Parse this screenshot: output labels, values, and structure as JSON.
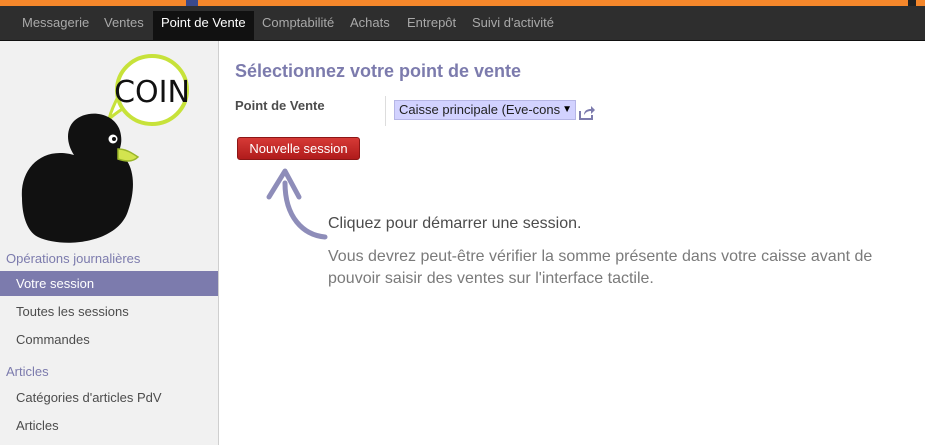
{
  "colors": {
    "accent": "#7c7bad",
    "top_stripe": "#f5872b",
    "navbar": "#2e2e2e",
    "button": "#c12b27"
  },
  "navbar": {
    "items": [
      "Messagerie",
      "Ventes",
      "Point de Vente",
      "Comptabilité",
      "Achats",
      "Entrepôt",
      "Suivi d'activité"
    ],
    "active": "Point de Vente"
  },
  "logo": {
    "bubble_text": "COIN"
  },
  "sidebar": {
    "section1": "Opérations journalières",
    "items1": [
      "Votre session",
      "Toutes les sessions",
      "Commandes"
    ],
    "active": "Votre session",
    "section2": "Articles",
    "items2": [
      "Catégories d'articles PdV",
      "Articles"
    ]
  },
  "main": {
    "title": "Sélectionnez votre point de vente",
    "field_label": "Point de Vente",
    "select_value": "Caisse principale (Eve-const",
    "select_arrow": "▼",
    "new_session_button": "Nouvelle session",
    "hint_title": "Cliquez pour démarrer une session.",
    "hint_body": "Vous devrez peut-être vérifier la somme présente dans votre caisse avant de pouvoir saisir des ventes sur l'interface tactile."
  }
}
